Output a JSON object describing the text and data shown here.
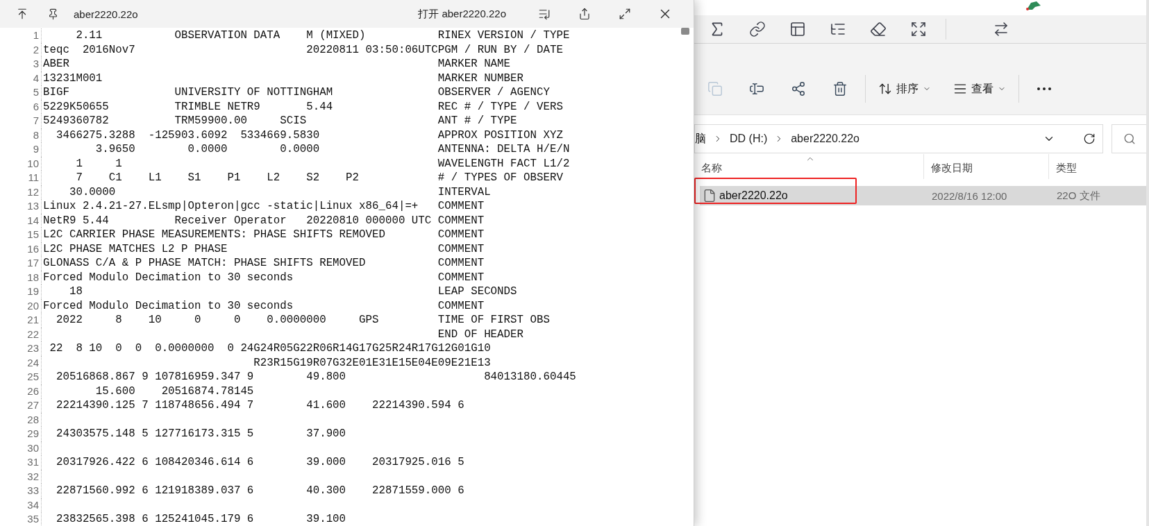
{
  "viewer": {
    "title": "aber2220.22o",
    "open_button": "打开 aber2220.22o",
    "lines": [
      {
        "number": "1",
        "text": "     2.11           OBSERVATION DATA    M (MIXED)           RINEX VERSION / TYPE"
      },
      {
        "number": "2",
        "text": "teqc  2016Nov7                          20220811 03:50:06UTCPGM / RUN BY / DATE"
      },
      {
        "number": "3",
        "text": "ABER                                                        MARKER NAME"
      },
      {
        "number": "4",
        "text": "13231M001                                                   MARKER NUMBER"
      },
      {
        "number": "5",
        "text": "BIGF                UNIVERSITY OF NOTTINGHAM                OBSERVER / AGENCY"
      },
      {
        "number": "6",
        "text": "5229K50655          TRIMBLE NETR9       5.44                REC # / TYPE / VERS"
      },
      {
        "number": "7",
        "text": "5249360782          TRM59900.00     SCIS                    ANT # / TYPE"
      },
      {
        "number": "8",
        "text": "  3466275.3288  -125903.6092  5334669.5830                  APPROX POSITION XYZ"
      },
      {
        "number": "9",
        "text": "        3.9650        0.0000        0.0000                  ANTENNA: DELTA H/E/N"
      },
      {
        "number": "10",
        "text": "     1     1                                                WAVELENGTH FACT L1/2"
      },
      {
        "number": "11",
        "text": "     7    C1    L1    S1    P1    L2    S2    P2            # / TYPES OF OBSERV"
      },
      {
        "number": "12",
        "text": "    30.0000                                                 INTERVAL"
      },
      {
        "number": "13",
        "text": "Linux 2.4.21-27.ELsmp|Opteron|gcc -static|Linux x86_64|=+   COMMENT"
      },
      {
        "number": "14",
        "text": "NetR9 5.44          Receiver Operator   20220810 000000 UTC COMMENT"
      },
      {
        "number": "15",
        "text": "L2C CARRIER PHASE MEASUREMENTS: PHASE SHIFTS REMOVED        COMMENT"
      },
      {
        "number": "16",
        "text": "L2C PHASE MATCHES L2 P PHASE                                COMMENT"
      },
      {
        "number": "17",
        "text": "GLONASS C/A & P PHASE MATCH: PHASE SHIFTS REMOVED           COMMENT"
      },
      {
        "number": "18",
        "text": "Forced Modulo Decimation to 30 seconds                      COMMENT"
      },
      {
        "number": "19",
        "text": "    18                                                      LEAP SECONDS"
      },
      {
        "number": "20",
        "text": "Forced Modulo Decimation to 30 seconds                      COMMENT"
      },
      {
        "number": "21",
        "text": "  2022     8    10     0     0    0.0000000     GPS         TIME OF FIRST OBS"
      },
      {
        "number": "22",
        "text": "                                                            END OF HEADER"
      },
      {
        "number": "23",
        "text": " 22  8 10  0  0  0.0000000  0 24G24R05G22R06R14G17G25R24R17G12G01G10"
      },
      {
        "number": "24",
        "text": "                                R23R15G19R07G32E01E31E15E04E09E21E13"
      },
      {
        "number": "25",
        "text": "  20516868.867 9 107816959.347 9        49.800                     84013180.60445"
      },
      {
        "number": "26",
        "text": "        15.600    20516874.78145"
      },
      {
        "number": "27",
        "text": "  22214390.125 7 118748656.494 7        41.600    22214390.594 6"
      },
      {
        "number": "28"
      },
      {
        "number": "29",
        "text": "  24303575.148 5 127716173.315 5        37.900"
      },
      {
        "number": "30"
      },
      {
        "number": "31",
        "text": "  20317926.422 6 108420346.614 6        39.000    20317925.016 5"
      },
      {
        "number": "32"
      },
      {
        "number": "33",
        "text": "  22871560.992 6 121918389.037 6        40.300    22871559.000 6"
      },
      {
        "number": "34"
      },
      {
        "number": "35",
        "text": "  23832565.398 6 125241045.179 6        39.100"
      }
    ]
  },
  "explorer": {
    "sort_button": "排序",
    "view_button": "查看",
    "breadcrumb": [
      "脑",
      "DD (H:)",
      "aber2220.22o"
    ],
    "columns": [
      "名称",
      "修改日期",
      "类型"
    ],
    "files": [
      {
        "name": "aber2220.22o",
        "modified": "2022/8/16 12:00",
        "type": "22O 文件",
        "selected": true
      }
    ]
  }
}
